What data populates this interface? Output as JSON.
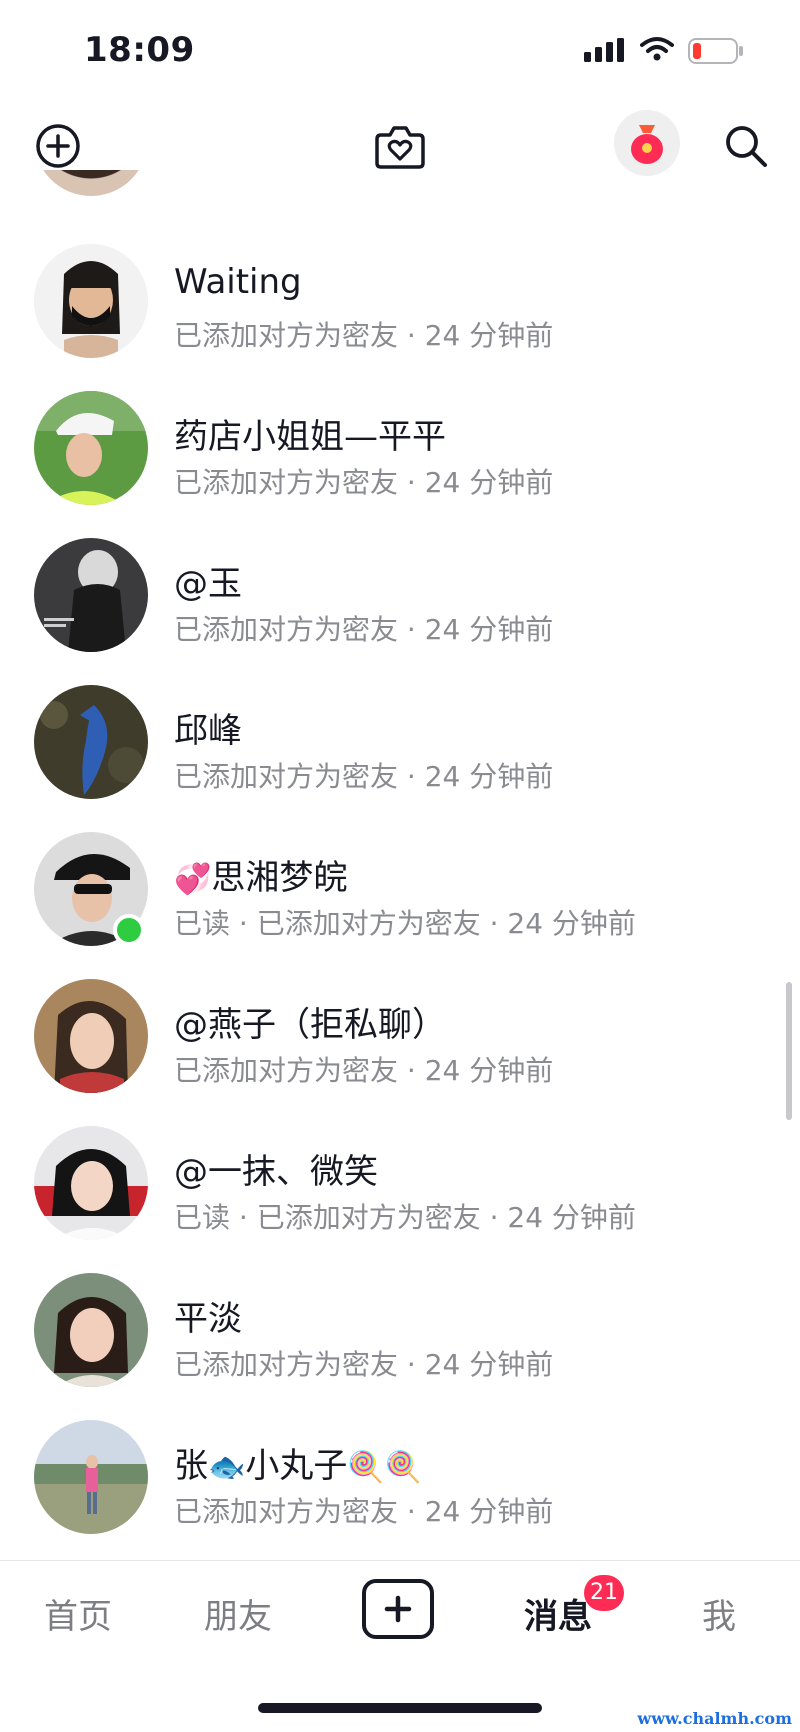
{
  "status_bar": {
    "time": "18:09"
  },
  "header": {
    "icons": [
      "add-circle-icon",
      "camera-heart-icon",
      "red-packet-icon",
      "search-icon"
    ]
  },
  "contacts": [
    {
      "name": "Waiting",
      "subtitle": "已添加对方为密友 · 24 分钟前",
      "online": false
    },
    {
      "name": "药店小姐姐—平平",
      "subtitle": "已添加对方为密友 · 24 分钟前",
      "online": false
    },
    {
      "name": "@玉",
      "subtitle": "已添加对方为密友 · 24 分钟前",
      "online": false
    },
    {
      "name": "邱峰",
      "subtitle": "已添加对方为密友 · 24 分钟前",
      "online": false
    },
    {
      "name": "思湘梦皖",
      "name_prefix_emoji": "💞",
      "subtitle": "已读 · 已添加对方为密友 · 24 分钟前",
      "online": true
    },
    {
      "name": "@燕子（拒私聊）",
      "subtitle": "已添加对方为密友 · 24 分钟前",
      "online": false
    },
    {
      "name": "@一抹、微笑",
      "subtitle": "已读 · 已添加对方为密友 · 24 分钟前",
      "online": false
    },
    {
      "name": "平淡",
      "subtitle": "已添加对方为密友 · 24 分钟前",
      "online": false
    },
    {
      "name_parts": [
        "张",
        "🐟",
        "小丸子",
        "🍭",
        "🍭"
      ],
      "subtitle": "已添加对方为密友 · 24 分钟前",
      "online": false
    }
  ],
  "tabbar": {
    "home": "首页",
    "friends": "朋友",
    "messages": "消息",
    "me": "我",
    "messages_badge": "21",
    "active": "messages"
  },
  "watermark": "www.chalmh.com"
}
